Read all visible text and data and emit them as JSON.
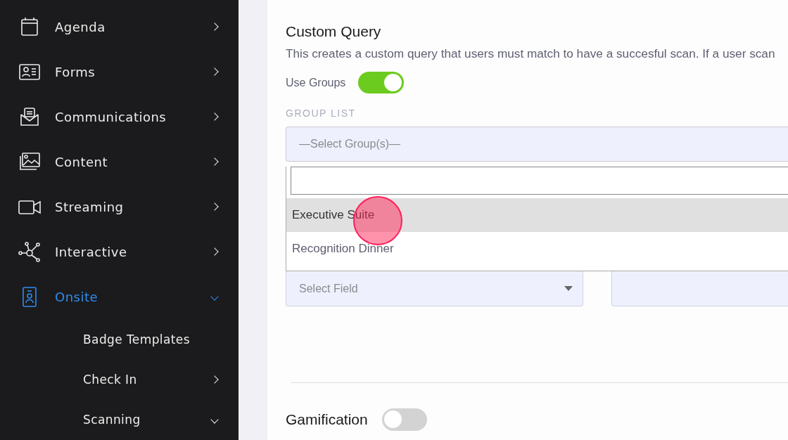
{
  "sidebar": {
    "items": [
      {
        "label": "Agenda",
        "selected": false,
        "expanded": false
      },
      {
        "label": "Forms",
        "selected": false,
        "expanded": false
      },
      {
        "label": "Communications",
        "selected": false,
        "expanded": false
      },
      {
        "label": "Content",
        "selected": false,
        "expanded": false
      },
      {
        "label": "Streaming",
        "selected": false,
        "expanded": false
      },
      {
        "label": "Interactive",
        "selected": false,
        "expanded": false
      },
      {
        "label": "Onsite",
        "selected": true,
        "expanded": true,
        "children": [
          {
            "label": "Badge Templates",
            "selected": false
          },
          {
            "label": "Check In",
            "selected": false,
            "expanded": false
          },
          {
            "label": "Scanning",
            "selected": false,
            "expanded": true
          }
        ]
      }
    ]
  },
  "custom_query": {
    "title": "Custom Query",
    "description": "This creates a custom query that users must match to have a succesful scan. If a user scan",
    "use_groups": {
      "label": "Use Groups",
      "on": true
    },
    "group_list": {
      "label": "GROUP LIST",
      "placeholder": "—Select Group(s)—",
      "options": [
        {
          "label": "Executive Suite",
          "selected": true
        },
        {
          "label": "Recognition Dinner",
          "selected": false
        }
      ]
    },
    "field_select": {
      "placeholder": "Select Field"
    }
  },
  "gamification": {
    "label": "Gamification",
    "on": false
  }
}
